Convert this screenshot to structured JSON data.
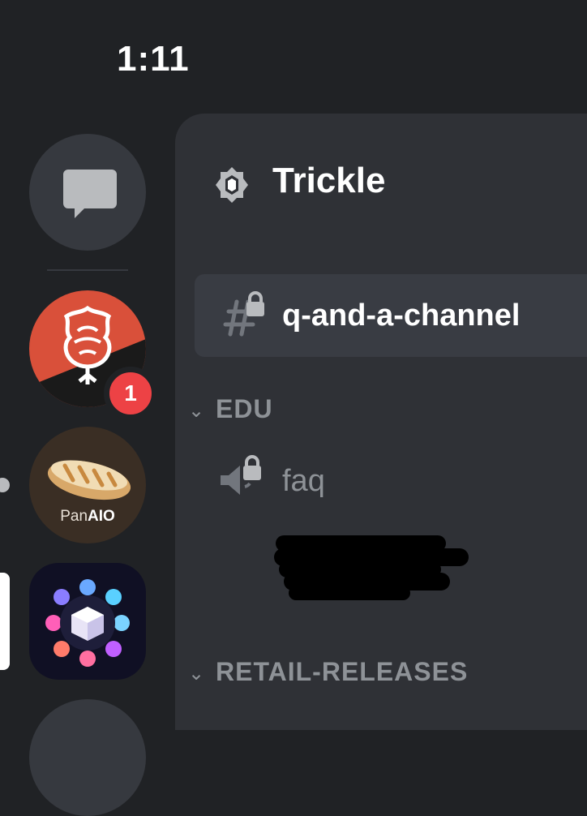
{
  "status_bar": {
    "time": "1:11"
  },
  "server_rail": {
    "dm_icon": "chat-bubble-icon",
    "servers": [
      {
        "name": "rose-server",
        "notification_count": "1"
      },
      {
        "name": "PanAIO",
        "logo_text_pan": "Pan",
        "logo_text_aio": "AIO"
      },
      {
        "name": "cube-server",
        "selected": true
      },
      {
        "name": "partial-server"
      }
    ]
  },
  "channel_panel": {
    "server_name": "Trickle",
    "channels": [
      {
        "name": "q-and-a-channel",
        "type": "locked-text",
        "active": true
      }
    ],
    "categories": [
      {
        "name": "EDU",
        "channels": [
          {
            "name": "faq",
            "type": "locked-voice"
          }
        ]
      },
      {
        "name": "RETAIL-RELEASES"
      }
    ]
  },
  "colors": {
    "background": "#202225",
    "panel": "#2f3136",
    "active_channel": "#393c43",
    "badge": "#ed4245",
    "muted_text": "#8e9297"
  }
}
